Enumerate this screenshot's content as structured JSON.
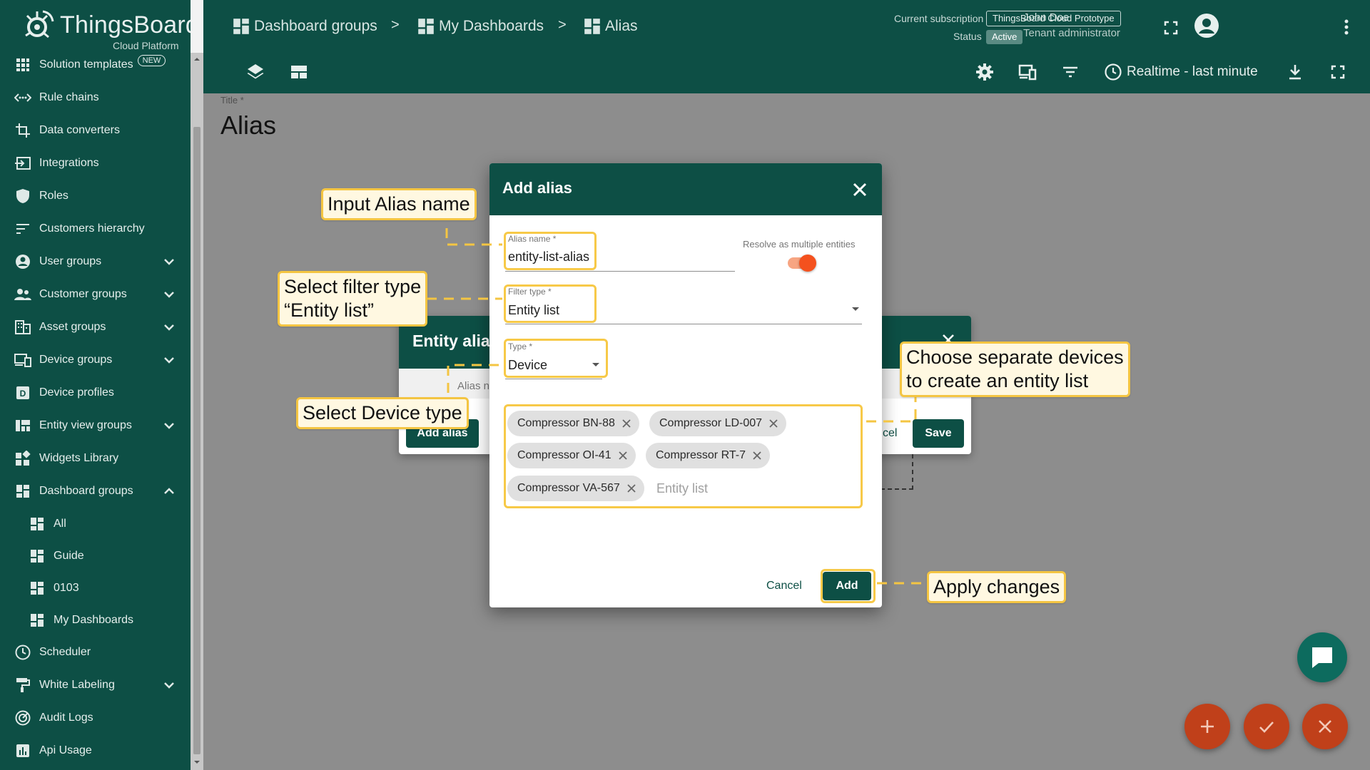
{
  "logo": {
    "title": "ThingsBoard",
    "subtitle": "Cloud Platform"
  },
  "sidebar": {
    "items": [
      {
        "label": "Solution templates",
        "icon": "grid-icon",
        "badge": "NEW"
      },
      {
        "label": "Rule chains",
        "icon": "rule-chain-icon"
      },
      {
        "label": "Data converters",
        "icon": "transform-icon"
      },
      {
        "label": "Integrations",
        "icon": "input-icon"
      },
      {
        "label": "Roles",
        "icon": "shield-icon"
      },
      {
        "label": "Customers hierarchy",
        "icon": "sort-icon"
      },
      {
        "label": "User groups",
        "icon": "account-circle-icon",
        "expandable": true
      },
      {
        "label": "Customer groups",
        "icon": "supervisor-icon",
        "expandable": true
      },
      {
        "label": "Asset groups",
        "icon": "domain-icon",
        "expandable": true
      },
      {
        "label": "Device groups",
        "icon": "devices-icon",
        "expandable": true
      },
      {
        "label": "Device profiles",
        "icon": "device-profile-icon"
      },
      {
        "label": "Entity view groups",
        "icon": "view-quilt-icon",
        "expandable": true
      },
      {
        "label": "Widgets Library",
        "icon": "widgets-icon"
      },
      {
        "label": "Dashboard groups",
        "icon": "dashboard-icon",
        "expanded": true
      },
      {
        "label": "All",
        "icon": "dashboard-icon",
        "sub": true
      },
      {
        "label": "Guide",
        "icon": "dashboard-icon",
        "sub": true
      },
      {
        "label": "0103",
        "icon": "dashboard-icon",
        "sub": true
      },
      {
        "label": "My Dashboards",
        "icon": "dashboard-icon",
        "sub": true
      },
      {
        "label": "Scheduler",
        "icon": "schedule-icon"
      },
      {
        "label": "White Labeling",
        "icon": "format-paint-icon",
        "expandable": true
      },
      {
        "label": "Audit Logs",
        "icon": "track-changes-icon"
      },
      {
        "label": "Api Usage",
        "icon": "insert-chart-icon"
      }
    ]
  },
  "breadcrumb": {
    "items": [
      "Dashboard groups",
      "My Dashboards",
      "Alias"
    ],
    "separator": ">"
  },
  "subscription": {
    "label": "Current subscription",
    "plan": "ThingsBoard Cloud Prototype",
    "status_label": "Status",
    "status": "Active"
  },
  "user": {
    "name": "John Doe",
    "role": "Tenant administrator"
  },
  "toolbar": {
    "timewindow": "Realtime - last minute"
  },
  "page": {
    "title_label": "Title *",
    "title": "Alias"
  },
  "bg_dialog": {
    "title": "Entity alias",
    "column": "Alias n",
    "add_label": "Add alias",
    "cancel_label": "cel",
    "save_label": "Save"
  },
  "dialog": {
    "title": "Add alias",
    "alias_name": {
      "label": "Alias name *",
      "value": "entity-list-alias"
    },
    "resolve_multiple": {
      "label": "Resolve as multiple entities",
      "enabled": true
    },
    "filter_type": {
      "label": "Filter type *",
      "value": "Entity list"
    },
    "type": {
      "label": "Type *",
      "value": "Device"
    },
    "entities": [
      "Compressor BN-88",
      "Compressor LD-007",
      "Compressor OI-41",
      "Compressor RT-7",
      "Compressor VA-567"
    ],
    "entity_list_placeholder": "Entity list",
    "cancel_label": "Cancel",
    "add_label": "Add"
  },
  "callouts": {
    "alias_name": "Input Alias name",
    "filter_type_1": "Select filter type",
    "filter_type_2": "“Entity list”",
    "device_type": "Select Device type",
    "devices_1": "Choose separate devices",
    "devices_2": "to create an entity list",
    "apply": "Apply changes"
  },
  "colors": {
    "primary": "#0d4f45",
    "accent": "#f4511e",
    "highlight": "#f7c948",
    "fab": "#c0401a"
  }
}
